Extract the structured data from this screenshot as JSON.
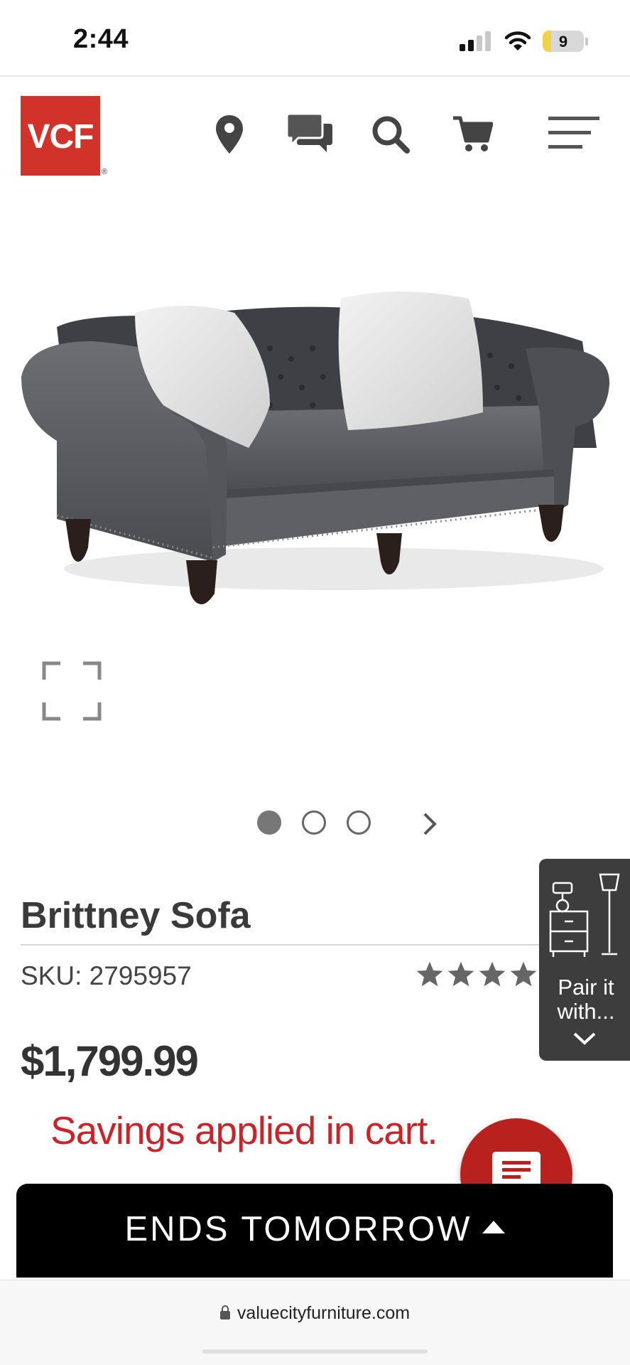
{
  "status_bar": {
    "time": "2:44",
    "battery": "9"
  },
  "header": {
    "logo_text": "VCF",
    "logo_reg": "®",
    "icons": [
      "location-pin-icon",
      "chat-icon",
      "search-icon",
      "cart-icon",
      "menu-icon"
    ],
    "brand_color": "#d1332b"
  },
  "gallery": {
    "image_description_icon": "sofa-image",
    "slide_count": 3,
    "active_slide": 1
  },
  "pair_widget": {
    "label": "Pair it with..."
  },
  "product": {
    "title": "Brittney Sofa",
    "sku": "SKU: 2795957",
    "rating_stars": 5,
    "price": "$1,799.99",
    "savings": "Savings applied in cart."
  },
  "banner": {
    "text": "ENDS TOMORROW"
  },
  "browser": {
    "url": "valuecityfurniture.com"
  },
  "colors": {
    "accent_red": "#c8242a",
    "chat_red": "#b8211d",
    "banner_bg": "#000000",
    "widget_bg": "#3d3d3d"
  }
}
